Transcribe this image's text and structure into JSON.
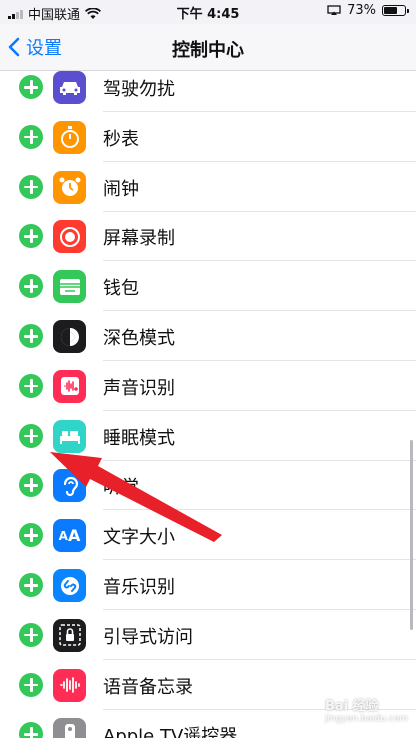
{
  "status_bar": {
    "carrier": "中国联通",
    "time": "下午 4:45",
    "battery_percent": "73%",
    "battery_level": 0.73
  },
  "nav": {
    "back_label": "设置",
    "title": "控制中心"
  },
  "items": [
    {
      "label": "驾驶勿扰",
      "icon": "car-icon",
      "color": "#5b4fcf"
    },
    {
      "label": "秒表",
      "icon": "stopwatch-icon",
      "color": "#ff9500"
    },
    {
      "label": "闹钟",
      "icon": "alarm-clock-icon",
      "color": "#ff9500"
    },
    {
      "label": "屏幕录制",
      "icon": "screen-record-icon",
      "color": "#ff3b30"
    },
    {
      "label": "钱包",
      "icon": "wallet-icon",
      "color": "#34c759"
    },
    {
      "label": "深色模式",
      "icon": "dark-mode-icon",
      "color": "#1c1c1e"
    },
    {
      "label": "声音识别",
      "icon": "sound-recognition-icon",
      "color": "#ff2d55"
    },
    {
      "label": "睡眠模式",
      "icon": "bed-icon",
      "color": "#30d5c8"
    },
    {
      "label": "听觉",
      "icon": "ear-icon",
      "color": "#0a7aff"
    },
    {
      "label": "文字大小",
      "icon": "text-size-icon",
      "color": "#0a7aff"
    },
    {
      "label": "音乐识别",
      "icon": "shazam-icon",
      "color": "#0a84ff"
    },
    {
      "label": "引导式访问",
      "icon": "lock-icon",
      "color": "#1c1c1e"
    },
    {
      "label": "语音备忘录",
      "icon": "voice-memo-icon",
      "color": "#ff2d55"
    },
    {
      "label": "Apple TV遥控器",
      "icon": "tv-remote-icon",
      "color": "#8e8e93"
    }
  ],
  "watermark": {
    "text": "Bai 经验",
    "sub": "jingyan.baidu.com"
  }
}
